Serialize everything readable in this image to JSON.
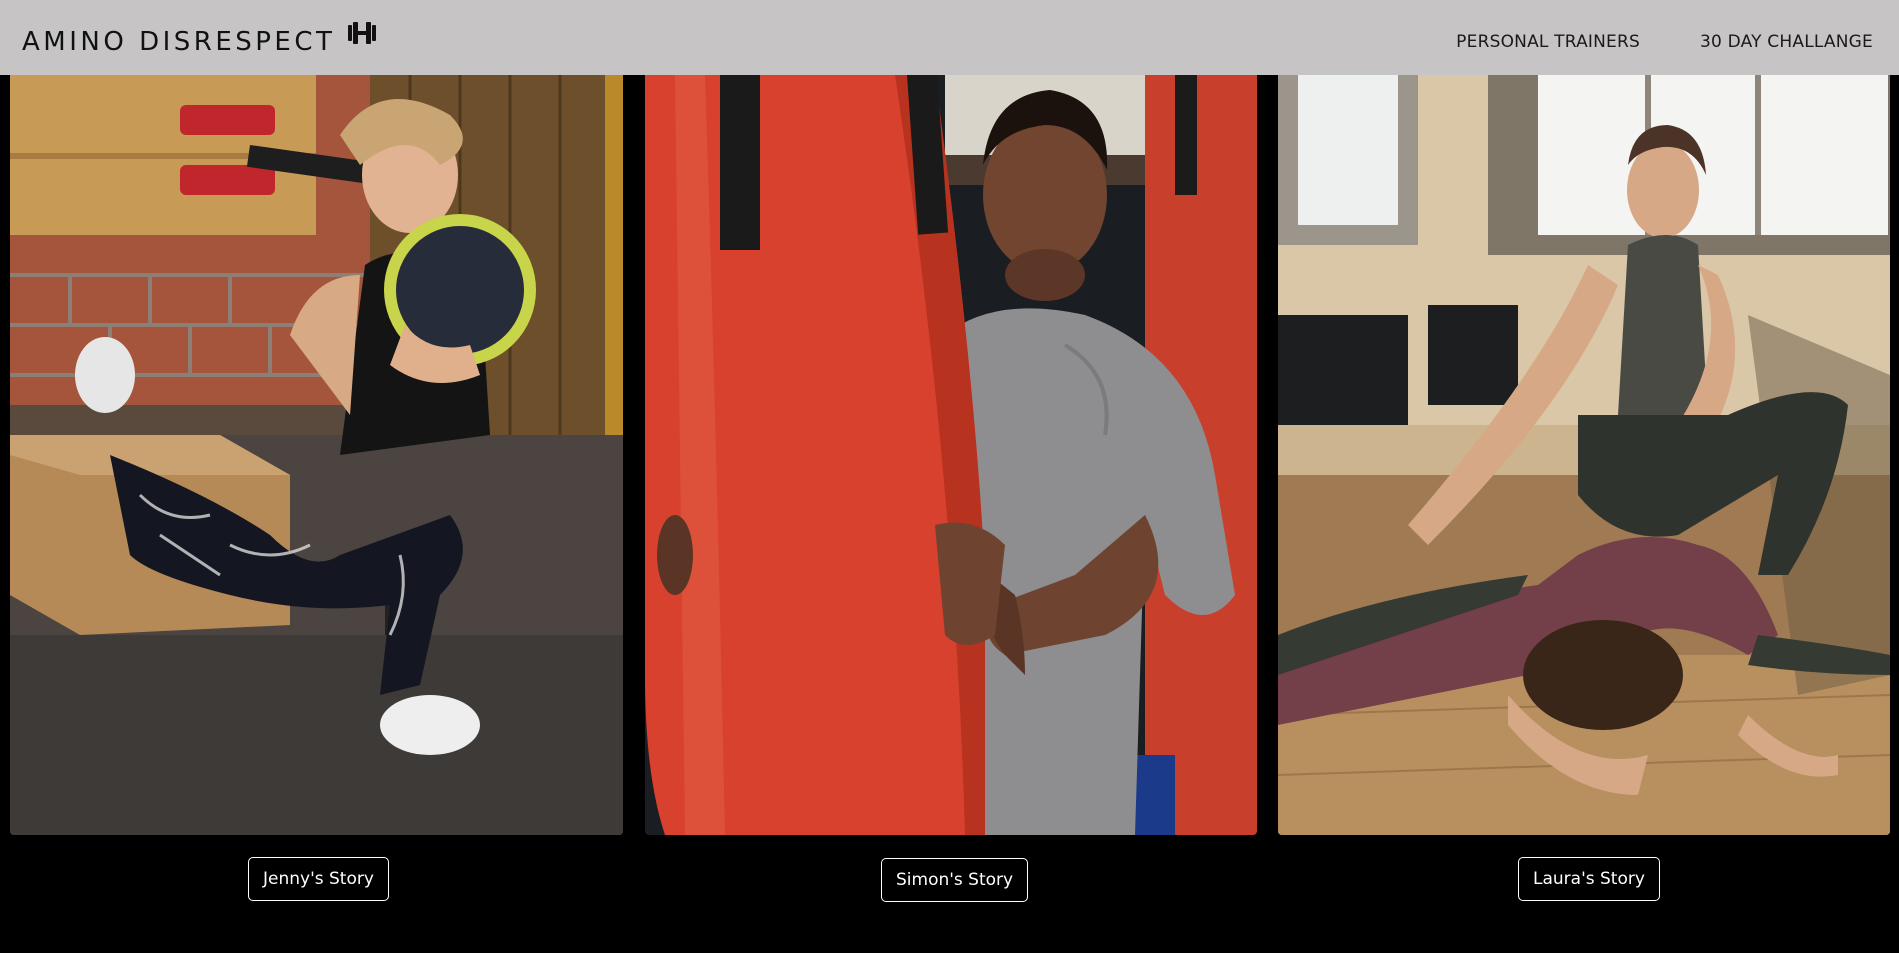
{
  "header": {
    "brand": "AMINO DISRESPECT",
    "brand_icon": "dumbbell-icon",
    "nav": [
      {
        "label": "PERSONAL TRAINERS"
      },
      {
        "label": "30 DAY CHALLANGE"
      }
    ]
  },
  "stories": [
    {
      "button_label": "Jenny's Story",
      "photo": "woman lunging with medicine ball in gym"
    },
    {
      "button_label": "Simon's Story",
      "photo": "man beside red punching bag"
    },
    {
      "button_label": "Laura's Story",
      "photo": "trainer assisting woman stretching on floor"
    }
  ],
  "colors": {
    "header_bg": "#c6c4c5",
    "page_bg": "#000000",
    "button_border": "#ffffff",
    "accent_red": "#d8412e"
  }
}
